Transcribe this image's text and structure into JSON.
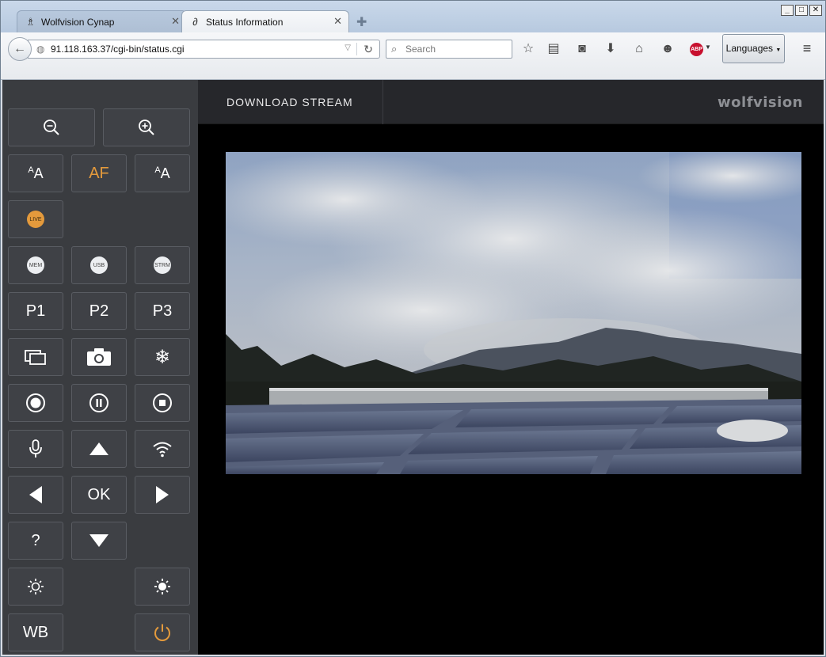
{
  "browser": {
    "tabs": [
      {
        "label": "Wolfvision Cynap",
        "active": false
      },
      {
        "label": "Status Information",
        "active": true
      }
    ],
    "url": "91.118.163.37/cgi-bin/status.cgi",
    "search_placeholder": "Search",
    "languages_label": "Languages",
    "abp_label": "ABP"
  },
  "header": {
    "download_label": "DOWNLOAD STREAM",
    "logo_text": "wolfvision"
  },
  "controls": {
    "af_label": "AF",
    "live_label": "LIVE",
    "mem_label": "MEM",
    "usb_label": "USB",
    "strm_label": "STRM",
    "p1_label": "P1",
    "p2_label": "P2",
    "p3_label": "P3",
    "ok_label": "OK",
    "help_label": "?",
    "wb_label": "WB"
  },
  "colors": {
    "accent_orange": "#e49a3c",
    "sidebar_bg": "#3a3c40",
    "header_bg": "#26272b"
  }
}
